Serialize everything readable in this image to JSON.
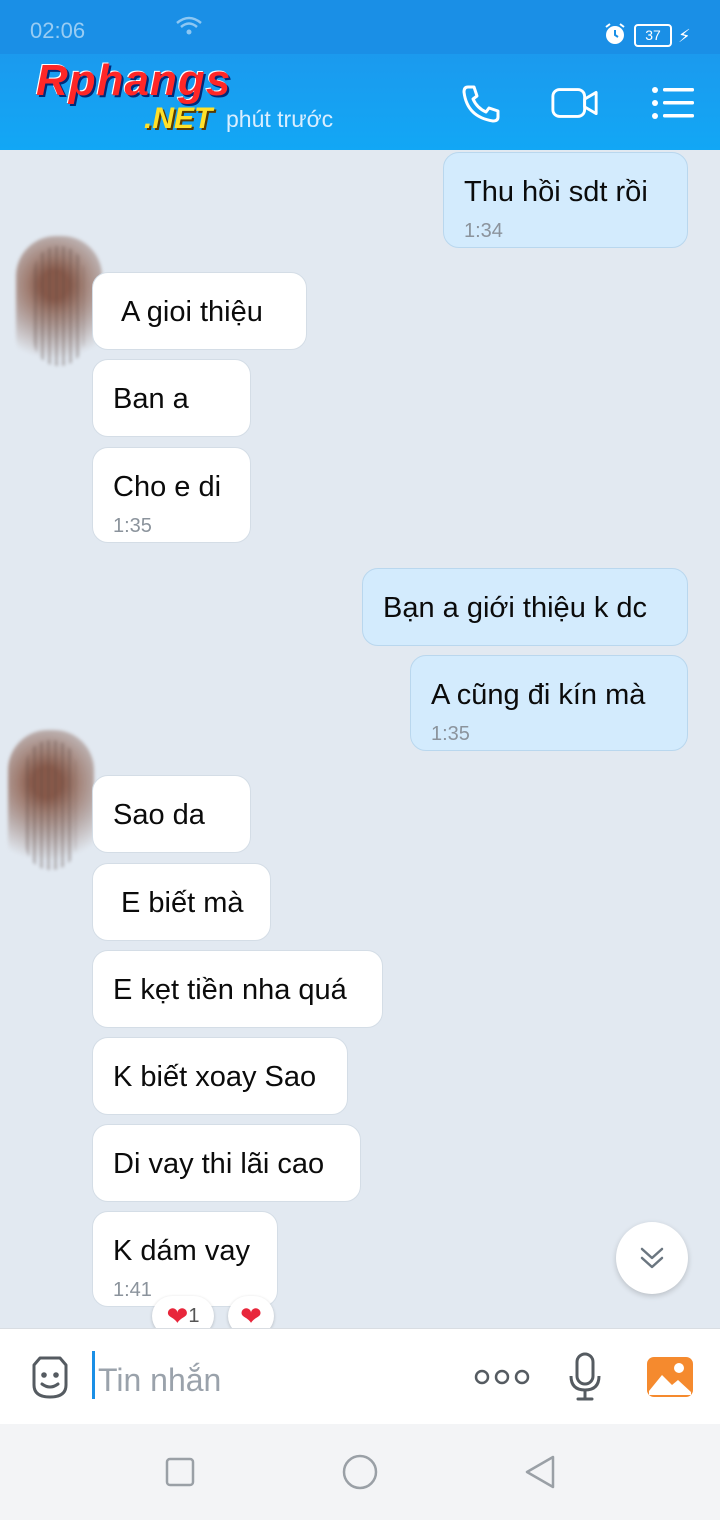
{
  "status_bar": {
    "time": "02:06",
    "battery": "37"
  },
  "watermark": {
    "brand": "Rphangs",
    "suffix": ".NET"
  },
  "header": {
    "last_seen": "phút trước",
    "icons": [
      "phone-icon",
      "video-call-icon",
      "menu-list-icon"
    ]
  },
  "messages": [
    {
      "side": "out",
      "text": "Thu hồi sdt rồi",
      "time": "1:34"
    },
    {
      "side": "in",
      "text": "A gioi thiệu"
    },
    {
      "side": "in",
      "text": "Ban a"
    },
    {
      "side": "in",
      "text": "Cho e di",
      "time": "1:35"
    },
    {
      "side": "out",
      "text": "Bạn a giới thiệu k dc"
    },
    {
      "side": "out",
      "text": "A cũng đi kín mà",
      "time": "1:35"
    },
    {
      "side": "in",
      "text": "Sao da"
    },
    {
      "side": "in",
      "text": "E biết mà"
    },
    {
      "side": "in",
      "text": "E kẹt tiền nha quá"
    },
    {
      "side": "in",
      "text": "K biết xoay Sao"
    },
    {
      "side": "in",
      "text": "Di vay thi lãi cao"
    },
    {
      "side": "in",
      "text": "K dám vay",
      "time": "1:41",
      "reactions": [
        {
          "icon": "heart-icon",
          "count": "1"
        },
        {
          "icon": "heart-icon"
        }
      ]
    }
  ],
  "composer": {
    "placeholder": "Tin nhắn"
  },
  "input_icons": [
    "emoji-icon",
    "more-icon",
    "microphone-icon",
    "gallery-icon"
  ],
  "nav_icons": [
    "recent-apps-icon",
    "home-icon",
    "back-icon"
  ],
  "colors": {
    "header": "#1a8fe6",
    "outgoing_bubble": "#d3ebfd",
    "incoming_bubble": "#ffffff",
    "background": "#e2e9f1"
  }
}
